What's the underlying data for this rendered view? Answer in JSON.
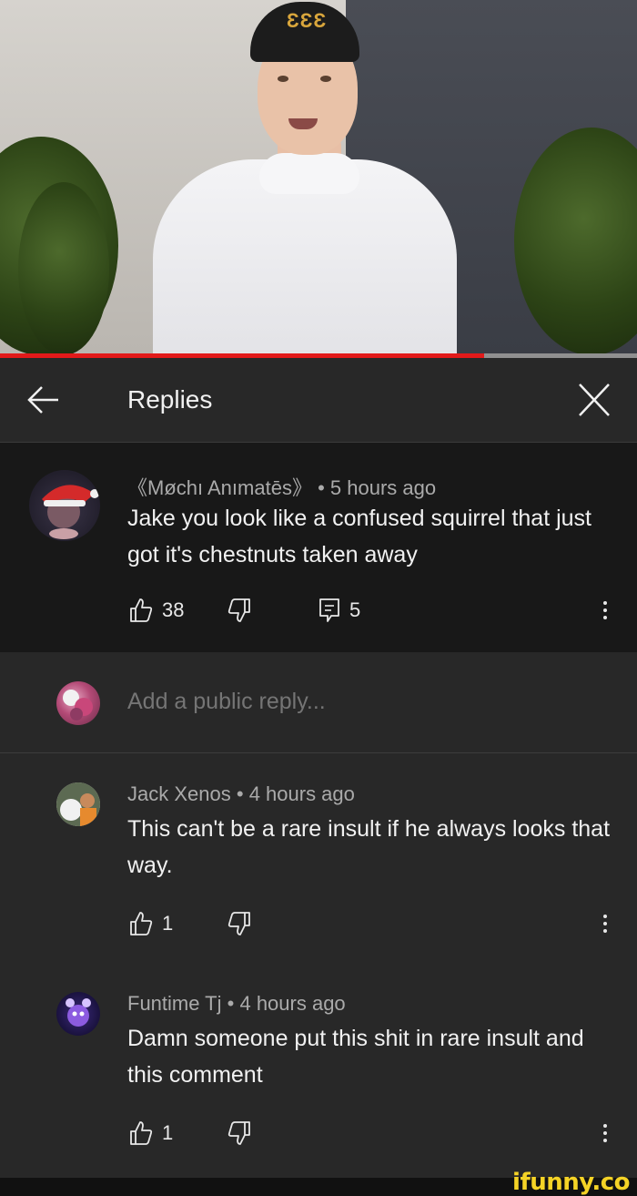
{
  "video": {
    "progress_fraction": 0.76
  },
  "header": {
    "title": "Replies",
    "back_icon": "arrow-left-icon",
    "close_icon": "close-icon"
  },
  "parent_comment": {
    "author": "《Møchı Anımatēs》",
    "separator": "•",
    "time": "5 hours ago",
    "text": "Jake you look like a confused squirrel that just got it's chestnuts taken away",
    "likes": "38",
    "replies": "5"
  },
  "add_reply": {
    "placeholder": "Add a public reply..."
  },
  "replies": [
    {
      "author": "Jack Xenos",
      "separator": "•",
      "time": "4 hours ago",
      "text": "This can't be a rare insult if he always looks that way.",
      "likes": "1"
    },
    {
      "author": "Funtime Tj",
      "separator": "•",
      "time": "4 hours ago",
      "text": "Damn someone put this shit in rare insult and this comment",
      "likes": "1"
    }
  ],
  "watermark": "ifunny.co",
  "colors": {
    "progress": "#e21a1a",
    "background": "#282828",
    "parent_background": "#181818",
    "watermark": "#f5d326"
  }
}
